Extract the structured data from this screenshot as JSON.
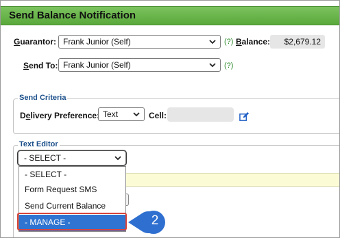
{
  "title": "Send Balance Notification",
  "guarantor": {
    "label_underlined": "G",
    "label_rest": "uarantor:",
    "value": "Frank Junior (Self)",
    "help": "(?)",
    "balance_label_underlined": "B",
    "balance_label_rest": "alance:",
    "balance_value": "$2,679.12"
  },
  "send_to": {
    "label_underlined": "S",
    "label_rest": "end To:",
    "value": "Frank Junior (Self)",
    "help": "(?)"
  },
  "send_criteria": {
    "legend": "Send Criteria",
    "delivery_label_pre": "D",
    "delivery_label_underlined": "e",
    "delivery_label_rest": "livery Preference:",
    "delivery_value": "Text",
    "cell_label": "Cell:",
    "cell_value": ""
  },
  "text_editor": {
    "legend": "Text Editor",
    "selected": "- SELECT -",
    "options": [
      "- SELECT -",
      "Form Request SMS",
      "Send Current Balance",
      "- MANAGE -"
    ],
    "highlighted_option": "- MANAGE -"
  },
  "callout": {
    "number": "2",
    "color": "#2f6fd0"
  },
  "colors": {
    "title_bar": "#5aa83b",
    "highlight_border": "#d9443b",
    "selected_option": "#2f74d0"
  }
}
